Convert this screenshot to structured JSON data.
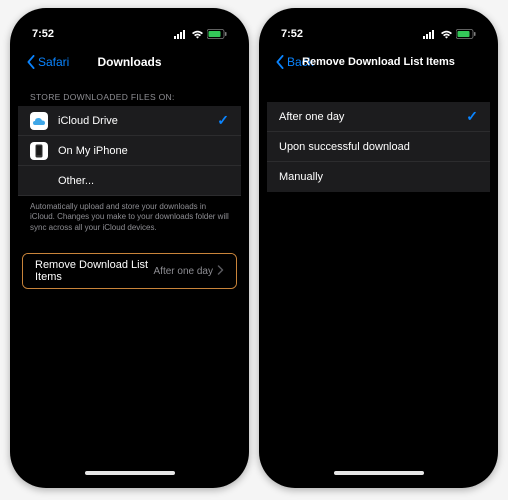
{
  "status": {
    "time": "7:52",
    "signal": "•••",
    "wifi": "wifi",
    "battery": "batt"
  },
  "left": {
    "back_label": "Safari",
    "title": "Downloads",
    "section_header": "Store Downloaded Files On:",
    "items": [
      {
        "label": "iCloud Drive",
        "selected": true
      },
      {
        "label": "On My iPhone",
        "selected": false
      },
      {
        "label": "Other...",
        "selected": false
      }
    ],
    "footer": "Automatically upload and store your downloads in iCloud. Changes you make to your downloads folder will sync across all your iCloud devices.",
    "remove_row": {
      "label": "Remove Download List Items",
      "value": "After one day"
    }
  },
  "right": {
    "back_label": "Back",
    "title": "Remove Download List Items",
    "options": [
      {
        "label": "After one day",
        "selected": true
      },
      {
        "label": "Upon successful download",
        "selected": false
      },
      {
        "label": "Manually",
        "selected": false
      }
    ]
  }
}
